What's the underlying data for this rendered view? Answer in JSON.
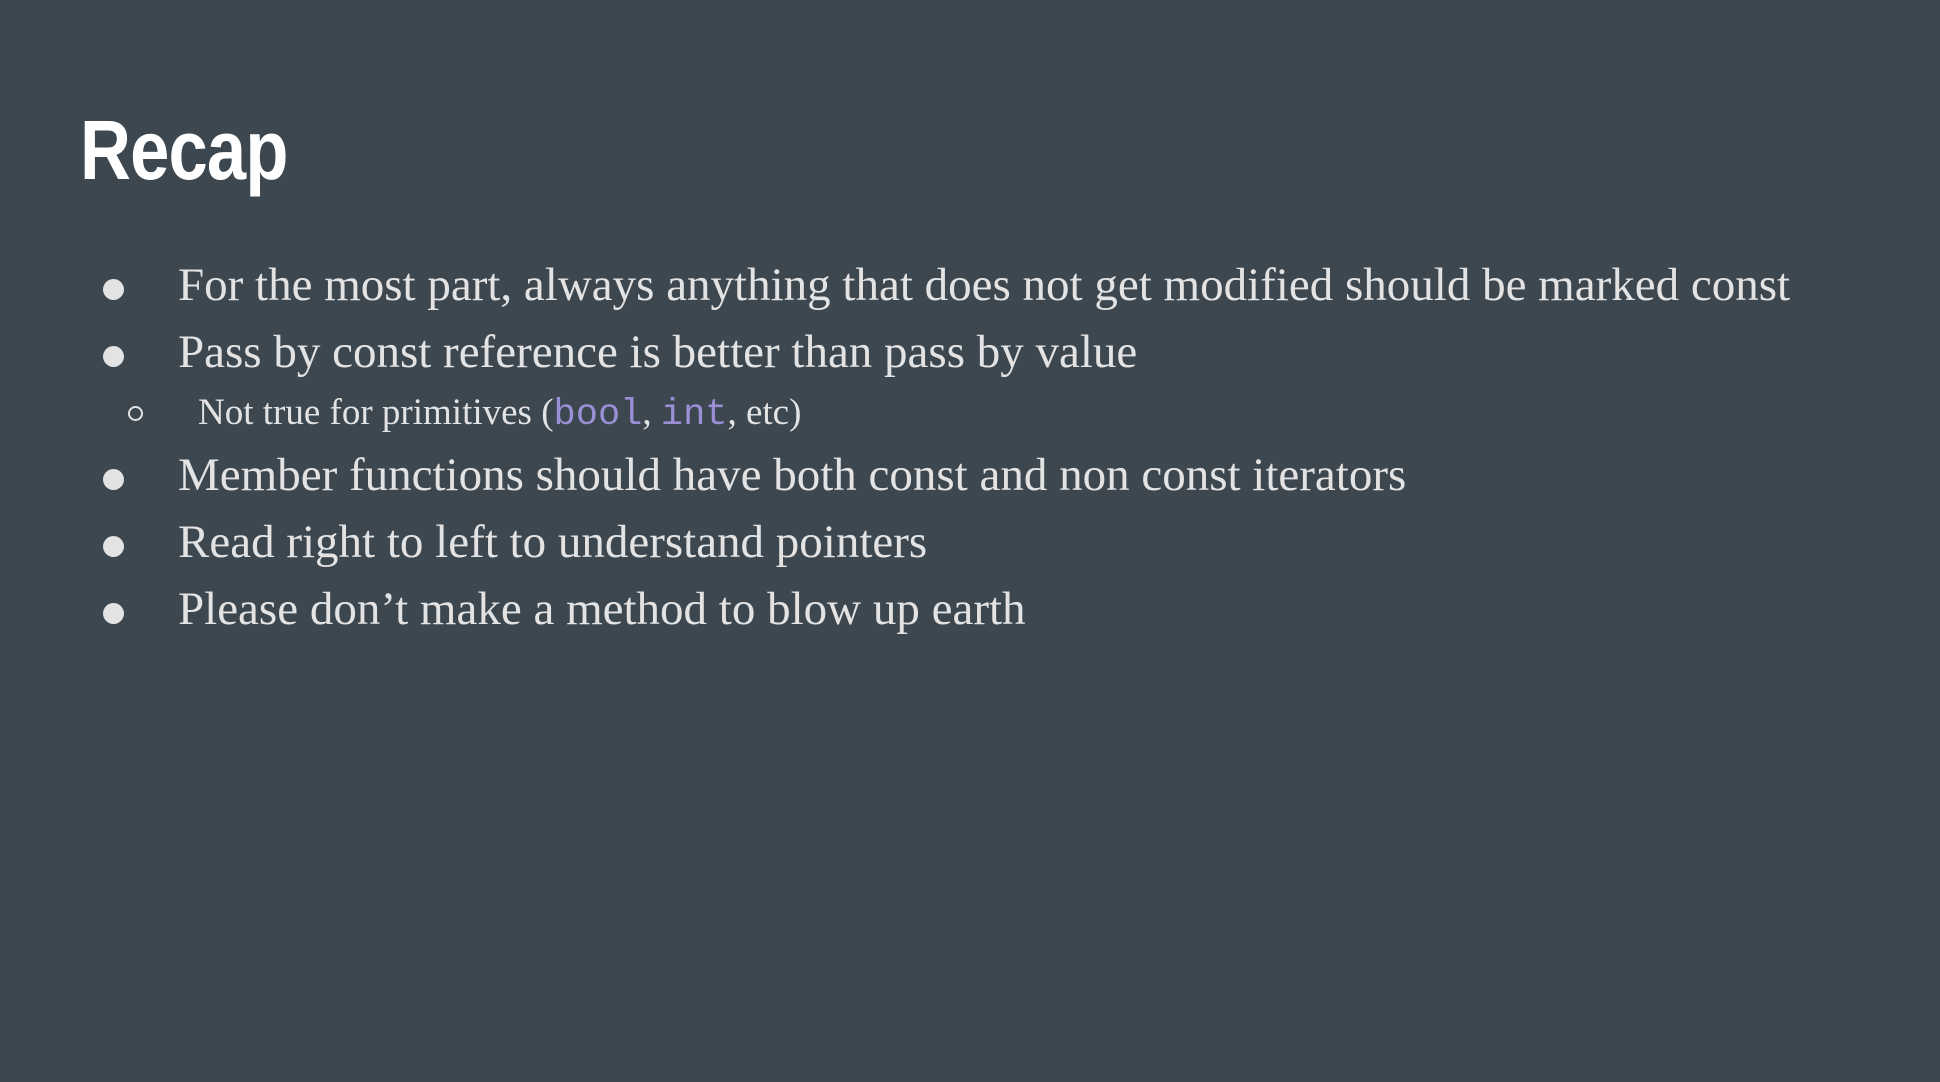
{
  "slide": {
    "title": "Recap",
    "bullets": [
      "For the most part, always anything that does not get modified should be marked const",
      "Pass by const reference is better than pass by value",
      "Member functions should have both const and non const iterators",
      "Read right to left to understand pointers",
      "Please don’t make a method to blow up earth"
    ],
    "sub_bullet": {
      "prefix": "Not true for primitives (",
      "code1": "bool",
      "sep1": ", ",
      "code2": "int",
      "suffix": ", etc)"
    }
  },
  "colors": {
    "background": "#3c4750",
    "title": "#ffffff",
    "text": "#e3e3e3",
    "code": "#9b8fd6"
  }
}
